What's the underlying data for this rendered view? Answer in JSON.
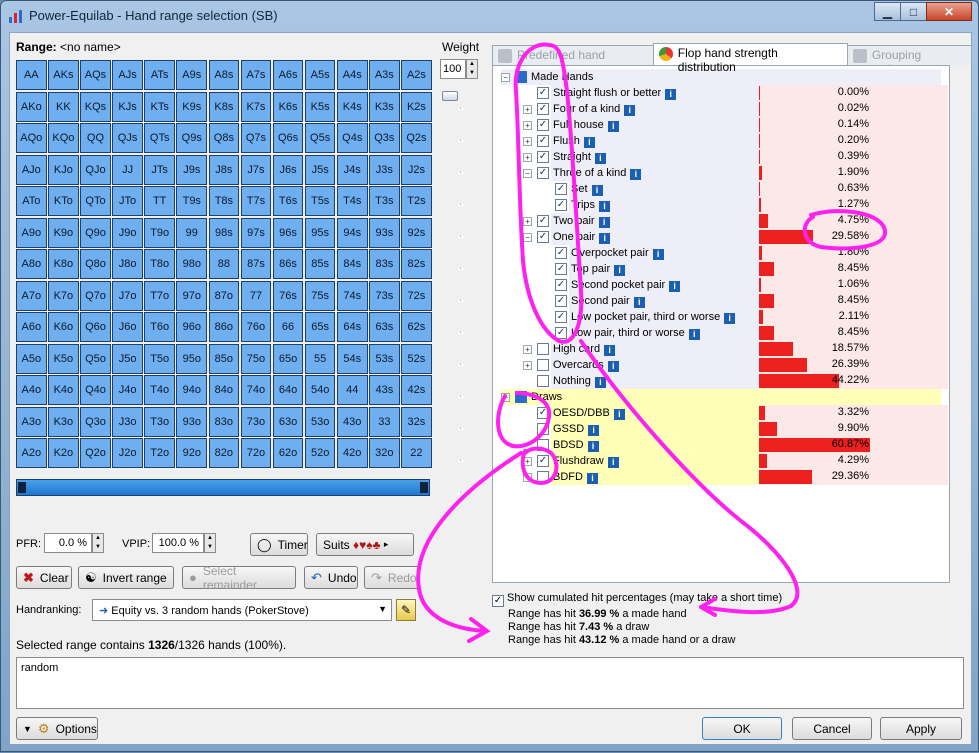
{
  "window": {
    "title": "Power-Equilab - Hand range selection (SB)"
  },
  "range": {
    "label": "Range:",
    "name": "<no name>"
  },
  "grid": [
    [
      "AA",
      "AKs",
      "AQs",
      "AJs",
      "ATs",
      "A9s",
      "A8s",
      "A7s",
      "A6s",
      "A5s",
      "A4s",
      "A3s",
      "A2s"
    ],
    [
      "AKo",
      "KK",
      "KQs",
      "KJs",
      "KTs",
      "K9s",
      "K8s",
      "K7s",
      "K6s",
      "K5s",
      "K4s",
      "K3s",
      "K2s"
    ],
    [
      "AQo",
      "KQo",
      "QQ",
      "QJs",
      "QTs",
      "Q9s",
      "Q8s",
      "Q7s",
      "Q6s",
      "Q5s",
      "Q4s",
      "Q3s",
      "Q2s"
    ],
    [
      "AJo",
      "KJo",
      "QJo",
      "JJ",
      "JTs",
      "J9s",
      "J8s",
      "J7s",
      "J6s",
      "J5s",
      "J4s",
      "J3s",
      "J2s"
    ],
    [
      "ATo",
      "KTo",
      "QTo",
      "JTo",
      "TT",
      "T9s",
      "T8s",
      "T7s",
      "T6s",
      "T5s",
      "T4s",
      "T3s",
      "T2s"
    ],
    [
      "A9o",
      "K9o",
      "Q9o",
      "J9o",
      "T9o",
      "99",
      "98s",
      "97s",
      "96s",
      "95s",
      "94s",
      "93s",
      "92s"
    ],
    [
      "A8o",
      "K8o",
      "Q8o",
      "J8o",
      "T8o",
      "98o",
      "88",
      "87s",
      "86s",
      "85s",
      "84s",
      "83s",
      "82s"
    ],
    [
      "A7o",
      "K7o",
      "Q7o",
      "J7o",
      "T7o",
      "97o",
      "87o",
      "77",
      "76s",
      "75s",
      "74s",
      "73s",
      "72s"
    ],
    [
      "A6o",
      "K6o",
      "Q6o",
      "J6o",
      "T6o",
      "96o",
      "86o",
      "76o",
      "66",
      "65s",
      "64s",
      "63s",
      "62s"
    ],
    [
      "A5o",
      "K5o",
      "Q5o",
      "J5o",
      "T5o",
      "95o",
      "85o",
      "75o",
      "65o",
      "55",
      "54s",
      "53s",
      "52s"
    ],
    [
      "A4o",
      "K4o",
      "Q4o",
      "J4o",
      "T4o",
      "94o",
      "84o",
      "74o",
      "64o",
      "54o",
      "44",
      "43s",
      "42s"
    ],
    [
      "A3o",
      "K3o",
      "Q3o",
      "J3o",
      "T3o",
      "93o",
      "83o",
      "73o",
      "63o",
      "53o",
      "43o",
      "33",
      "32s"
    ],
    [
      "A2o",
      "K2o",
      "Q2o",
      "J2o",
      "T2o",
      "92o",
      "82o",
      "72o",
      "62o",
      "52o",
      "42o",
      "32o",
      "22"
    ]
  ],
  "weight": {
    "label": "Weight",
    "value": "100"
  },
  "tabs": [
    {
      "label": "Predefined hand ranges",
      "icon": "cards-icon"
    },
    {
      "label": "Flop hand strength distribution",
      "icon": "pie-chart-icon"
    },
    {
      "label": "Grouping options",
      "icon": "gears-icon"
    }
  ],
  "tree": [
    {
      "label": "Made Hands",
      "level": 0,
      "header": true,
      "kind": "made",
      "expander": "−",
      "checkbox": "tri"
    },
    {
      "label": "Straight flush or better",
      "level": 1,
      "kind": "made",
      "checked": true,
      "pct": "0.00%",
      "value": 0.0
    },
    {
      "label": "Four of a kind",
      "level": 1,
      "kind": "made",
      "checked": true,
      "expander": "+",
      "pct": "0.02%",
      "value": 0.02
    },
    {
      "label": "Full house",
      "level": 1,
      "kind": "made",
      "checked": true,
      "expander": "+",
      "pct": "0.14%",
      "value": 0.14
    },
    {
      "label": "Flush",
      "level": 1,
      "kind": "made",
      "checked": true,
      "expander": "+",
      "pct": "0.20%",
      "value": 0.2
    },
    {
      "label": "Straight",
      "level": 1,
      "kind": "made",
      "checked": true,
      "expander": "+",
      "pct": "0.39%",
      "value": 0.39
    },
    {
      "label": "Three of a kind",
      "level": 1,
      "kind": "made",
      "checked": true,
      "expander": "−",
      "pct": "1.90%",
      "value": 1.9
    },
    {
      "label": "Set",
      "level": 2,
      "kind": "made",
      "checked": true,
      "pct": "0.63%",
      "value": 0.63
    },
    {
      "label": "Trips",
      "level": 2,
      "kind": "made",
      "checked": true,
      "pct": "1.27%",
      "value": 1.27
    },
    {
      "label": "Two pair",
      "level": 1,
      "kind": "made",
      "checked": true,
      "expander": "+",
      "pct": "4.75%",
      "value": 4.75
    },
    {
      "label": "One pair",
      "level": 1,
      "kind": "made",
      "checked": true,
      "expander": "−",
      "pct": "29.58%",
      "value": 29.58
    },
    {
      "label": "Overpocket pair",
      "level": 2,
      "kind": "made",
      "checked": true,
      "pct": "1.80%",
      "value": 1.8
    },
    {
      "label": "Top pair",
      "level": 2,
      "kind": "made",
      "checked": true,
      "pct": "8.45%",
      "value": 8.45
    },
    {
      "label": "Second pocket pair",
      "level": 2,
      "kind": "made",
      "checked": true,
      "pct": "1.06%",
      "value": 1.06
    },
    {
      "label": "Second pair",
      "level": 2,
      "kind": "made",
      "checked": true,
      "pct": "8.45%",
      "value": 8.45
    },
    {
      "label": "Low pocket pair, third or worse",
      "level": 2,
      "kind": "made",
      "checked": true,
      "pct": "2.11%",
      "value": 2.11
    },
    {
      "label": "Low pair, third or worse",
      "level": 2,
      "kind": "made",
      "checked": true,
      "pct": "8.45%",
      "value": 8.45
    },
    {
      "label": "High card",
      "level": 1,
      "kind": "made",
      "checked": false,
      "expander": "+",
      "pct": "18.57%",
      "value": 18.57
    },
    {
      "label": "Overcards",
      "level": 1,
      "kind": "made",
      "checked": false,
      "expander": "+",
      "pct": "26.39%",
      "value": 26.39
    },
    {
      "label": "Nothing",
      "level": 1,
      "kind": "made",
      "checked": false,
      "pct": "44.22%",
      "value": 44.22
    },
    {
      "label": "Draws",
      "level": 0,
      "header": true,
      "kind": "draw",
      "expander": "−",
      "checkbox": "tri"
    },
    {
      "label": "OESD/DBB",
      "level": 1,
      "kind": "draw",
      "checked": true,
      "pct": "3.32%",
      "value": 3.32
    },
    {
      "label": "GSSD",
      "level": 1,
      "kind": "draw",
      "checked": false,
      "pct": "9.90%",
      "value": 9.9
    },
    {
      "label": "BDSD",
      "level": 1,
      "kind": "draw",
      "checked": false,
      "pct": "60.87%",
      "value": 60.87
    },
    {
      "label": "Flushdraw",
      "level": 1,
      "kind": "draw",
      "checked": true,
      "expander": "+",
      "pct": "4.29%",
      "value": 4.29
    },
    {
      "label": "BDFD",
      "level": 1,
      "kind": "draw",
      "checked": false,
      "expander": "+",
      "pct": "29.36%",
      "value": 29.36
    }
  ],
  "stats": {
    "show_cumulated": "Show cumulated hit percentages (may take a short time)",
    "lines": [
      {
        "prefix": "Range has hit ",
        "value": "36.99 %",
        "suffix": " a made hand"
      },
      {
        "prefix": "Range has hit ",
        "value": "7.43 %",
        "suffix": " a draw"
      },
      {
        "prefix": "Range has hit ",
        "value": "43.12 %",
        "suffix": " a made hand or a draw"
      }
    ]
  },
  "controls": {
    "pfr_label": "PFR:",
    "pfr_value": "0.0 %",
    "vpip_label": "VPIP:",
    "vpip_value": "100.0 %",
    "timer": "Timer",
    "suits": "Suits",
    "suit_glyphs": "♦♥♠♣",
    "clear": "Clear",
    "invert": "Invert range",
    "select_remainder": "Select remainder",
    "undo": "Undo",
    "redo": "Redo",
    "handranking_label": "Handranking:",
    "handranking_value": "Equity vs. 3 random hands (PokerStove)"
  },
  "summary": {
    "prefix": "Selected range contains ",
    "count": "1326",
    "total": "/1326 hands (100%)."
  },
  "textarea": {
    "value": "random"
  },
  "footer": {
    "options": "Options",
    "ok": "OK",
    "cancel": "Cancel",
    "apply": "Apply"
  },
  "colors": {
    "cell": "#6faeef",
    "bar": "#ed2020",
    "annotation": "#ff22ee"
  }
}
